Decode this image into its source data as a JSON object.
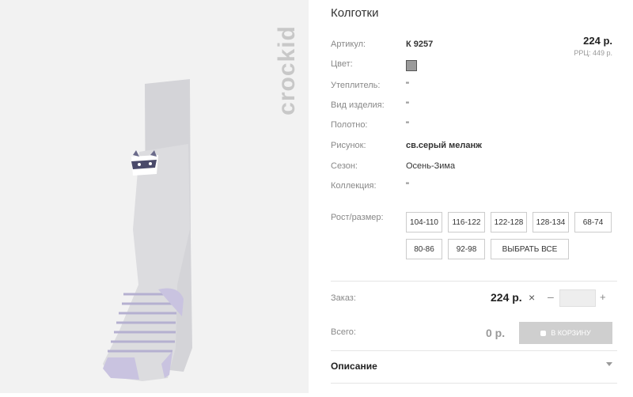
{
  "brand": "crockid",
  "title": "Колготки",
  "price": "224 р.",
  "rrp": "РРЦ: 449 р.",
  "attributes": [
    {
      "label": "Артикул:",
      "value": "К 9257"
    },
    {
      "label": "Цвет:",
      "value": ""
    },
    {
      "label": "Утеплитель:",
      "value": "\""
    },
    {
      "label": "Вид изделия:",
      "value": "\""
    },
    {
      "label": "Полотно:",
      "value": "\""
    },
    {
      "label": "Рисунок:",
      "value": "св.серый меланж"
    },
    {
      "label": "Сезон:",
      "value": "Осень-Зима"
    },
    {
      "label": "Коллекция:",
      "value": "\""
    }
  ],
  "colors": {
    "swatch": "#9a9a9a",
    "sock": "#dcdcdf",
    "stripe": "#b5b0d0",
    "heel": "#c9c3e0"
  },
  "sizes_label": "Рост/размер:",
  "sizes": [
    "104-110",
    "116-122",
    "122-128",
    "128-134",
    "68-74",
    "80-86",
    "92-98"
  ],
  "select_all": "ВЫБРАТЬ ВСЕ",
  "order": {
    "label": "Заказ:",
    "price": "224 р.",
    "quantity": ""
  },
  "total": {
    "label": "Всего:",
    "value": "0 р.",
    "button": "В КОРЗИНУ"
  },
  "description": "Описание"
}
